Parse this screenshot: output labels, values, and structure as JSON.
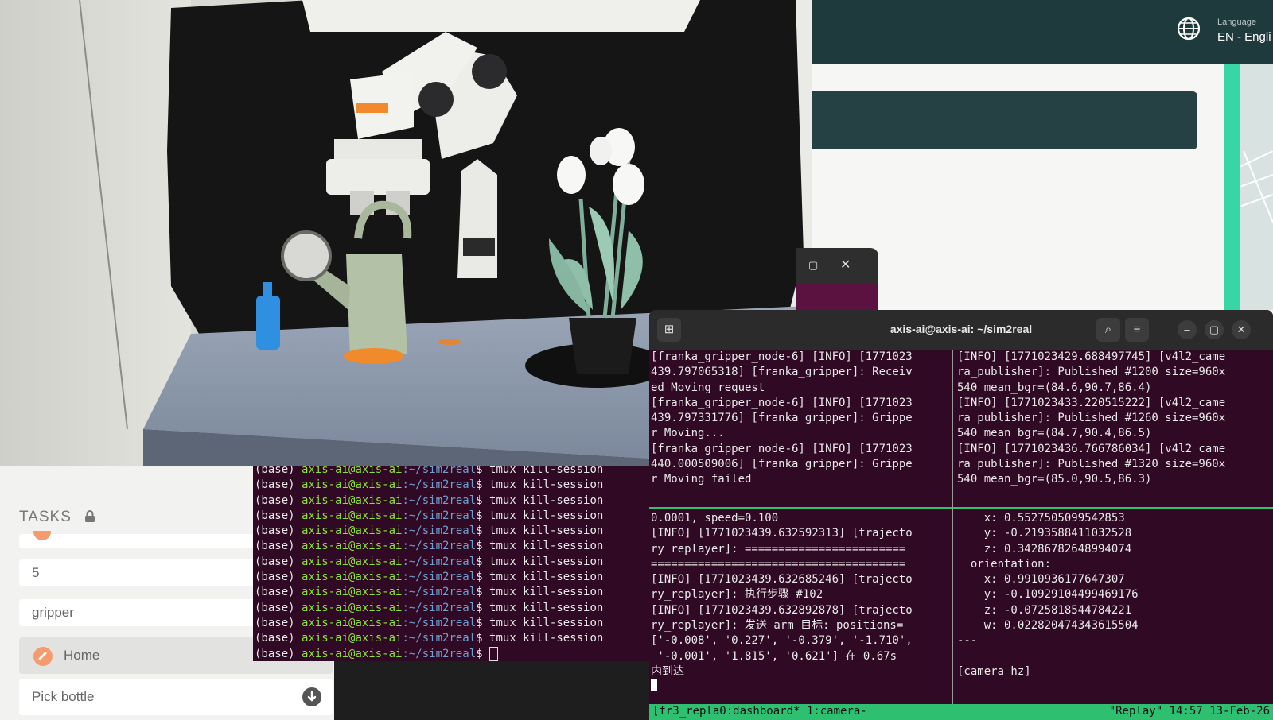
{
  "bg_app": {
    "language_label": "Language",
    "language_value": "EN - Engli",
    "icons": {
      "globe": "globe-icon"
    },
    "colors": {
      "header": "#1f3a3d",
      "accent": "#38d6a6"
    }
  },
  "tasks_panel": {
    "title": "TASKS",
    "icons": {
      "lock": "lock-icon",
      "home": "orange-circle-icon",
      "download": "download-circle-icon"
    },
    "items": [
      {
        "label": "5"
      },
      {
        "label": "gripper"
      },
      {
        "label": "Home"
      },
      {
        "label": "Pick bottle"
      }
    ]
  },
  "small_window": {
    "max_glyph": "▢",
    "close_glyph": "✕"
  },
  "shell_terminal": {
    "prompt_env": "(base) ",
    "prompt_host": "axis-ai@axis-ai",
    "prompt_path": ":~/sim2real",
    "command": "$ tmux kill-session",
    "last_prompt_suffix": "$ "
  },
  "terminal": {
    "title": "axis-ai@axis-ai: ~/sim2real",
    "buttons": {
      "new_tab": "⊞",
      "search": "⌕",
      "menu": "≡",
      "minimize": "–",
      "maximize": "▢",
      "close": "✕"
    },
    "pane_top_left": [
      "[franka_gripper_node-6] [INFO] [1771023",
      "439.797065318] [franka_gripper]: Receiv",
      "ed Moving request",
      "[franka_gripper_node-6] [INFO] [1771023",
      "439.797331776] [franka_gripper]: Grippe",
      "r Moving...",
      "[franka_gripper_node-6] [INFO] [1771023",
      "440.000509006] [franka_gripper]: Grippe",
      "r Moving failed"
    ],
    "pane_top_right": [
      "[INFO] [1771023429.688497745] [v4l2_came",
      "ra_publisher]: Published #1200 size=960x",
      "540 mean_bgr=(84.6,90.7,86.4)",
      "[INFO] [1771023433.220515222] [v4l2_came",
      "ra_publisher]: Published #1260 size=960x",
      "540 mean_bgr=(84.7,90.4,86.5)",
      "[INFO] [1771023436.766786034] [v4l2_came",
      "ra_publisher]: Published #1320 size=960x",
      "540 mean_bgr=(85.0,90.5,86.3)"
    ],
    "pane_bottom_left": [
      "0.0001, speed=0.100",
      "[INFO] [1771023439.632592313] [trajecto",
      "ry_replayer]: ========================",
      "======================================",
      "[INFO] [1771023439.632685246] [trajecto",
      "ry_replayer]: 执行步骤 #102",
      "[INFO] [1771023439.632892878] [trajecto",
      "ry_replayer]: 发送 arm 目标: positions=",
      "['-0.008', '0.227', '-0.379', '-1.710',",
      " '-0.001', '1.815', '0.621'] 在 0.67s",
      "内到达"
    ],
    "pane_bottom_right": [
      "    x: 0.5527505099542853",
      "    y: -0.2193588411032528",
      "    z: 0.34286782648994074",
      "  orientation:",
      "    x: 0.9910936177647307",
      "    y: -0.10929104499469176",
      "    z: -0.0725818544784221",
      "    w: 0.022820474343615504",
      "---",
      "",
      "[camera hz]"
    ],
    "status_left": "[fr3_repla0:dashboard* 1:camera-",
    "status_right": "\"Replay\" 14:57 13-Feb-26",
    "colors": {
      "background": "#300a24",
      "status_bar": "#2fbf71"
    }
  }
}
